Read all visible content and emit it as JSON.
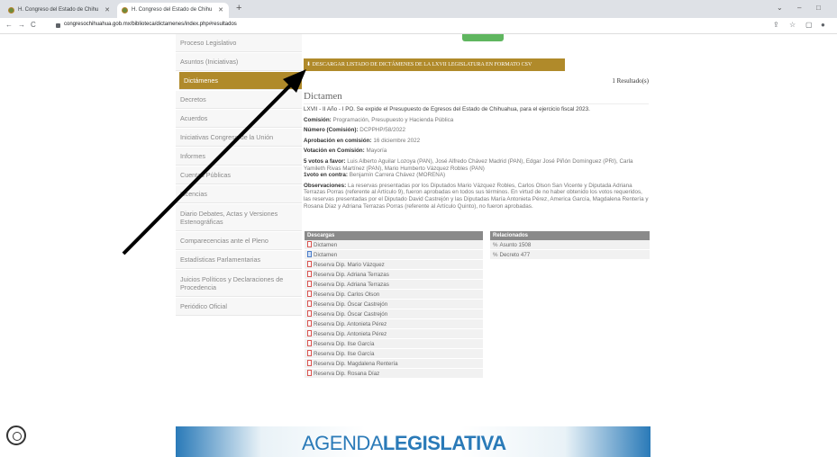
{
  "browser": {
    "tabs": [
      {
        "title": "H. Congreso del Estado de Chihu"
      },
      {
        "title": "H. Congreso del Estado de Chihu"
      }
    ],
    "url": "congresochihuahua.gob.mx/biblioteca/dictamenes/index.php#resultados"
  },
  "sidebar": {
    "items": [
      {
        "label": "Proceso Legislativo"
      },
      {
        "label": "Asuntos (Iniciativas)"
      },
      {
        "label": "Dictámenes"
      },
      {
        "label": "Decretos"
      },
      {
        "label": "Acuerdos"
      },
      {
        "label": "Iniciativas Congreso de la Unión"
      },
      {
        "label": "Informes"
      },
      {
        "label": "Cuentas Públicas"
      },
      {
        "label": "Licencias"
      },
      {
        "label": "Diario Debates, Actas y Versiones Estenográficas"
      },
      {
        "label": "Comparecencias ante el Pleno"
      },
      {
        "label": "Estadísticas Parlamentarias"
      },
      {
        "label": "Juicios Políticos y Declaraciones de Procedencia"
      },
      {
        "label": "Periódico Oficial"
      }
    ]
  },
  "main": {
    "csv_button": "DESCARGAR LISTADO DE DICTÁMENES DE LA LXVII LEGISLATURA EN FORMATO CSV",
    "results": "1 Resultado(s)",
    "title": "Dictamen",
    "summary": "LXVII - II Año - I PO. Se expide el Presupuesto de Egresos del Estado de Chihuahua, para el ejercicio fiscal 2023.",
    "comision_label": "Comisión:",
    "comision_value": "Programación, Presupuesto y Hacienda Pública",
    "numero_label": "Número (Comisión):",
    "numero_value": "DCPPHP/58/2022",
    "aprobacion_label": "Aprobación en comisión:",
    "aprobacion_value": "16 diciembre 2022",
    "votacion_label": "Votación en Comisión:",
    "votacion_value": "Mayoría",
    "favor_label": "5 votos a favor:",
    "favor_value": "Luis Alberto Aguilar Lozoya (PAN), José Alfredo Chávez Madrid (PAN), Edgar José Piñón Domínguez (PRI), Carla Yamileth Rivas Martínez (PAN), Mario Humberto Vázquez Robles (PAN)",
    "contra_label": "1voto en contra:",
    "contra_value": "Benjamín Carrera Chávez (MORENA)",
    "obs_label": "Observaciones:",
    "obs_value": "La reservas presentadas por los Diputados Mario Vázquez Robles, Carlos Olson San Vicente y Diputada Adriana Terrazas Porras (referente al Artículo 9), fueron aprobadas en todos sus términos. En virtud de no haber obtenido los votos requeridos, las reservas presentadas por el Diputado David Castrejón y las Diputadas María Antonieta Pérez, America García, Magdalena Rentería y Rosana Díaz y Adriana Terrazas Porras (referente al Artículo Quinto), no fueron aprobadas."
  },
  "downloads": {
    "header": "Descargas",
    "items": [
      {
        "label": "Dictamen",
        "icon": "pdf-icon"
      },
      {
        "label": "Dictamen",
        "icon": "word-icon"
      },
      {
        "label": "Reserva Dip. Mario Vázquez",
        "icon": "pdf-icon"
      },
      {
        "label": "Reserva Dip. Adriana Terrazas",
        "icon": "pdf-icon"
      },
      {
        "label": "Reserva Dip. Adriana Terrazas",
        "icon": "pdf-icon"
      },
      {
        "label": "Reserva Dip. Carlos Olson",
        "icon": "pdf-icon"
      },
      {
        "label": "Reserva Dip. Óscar Castrejón",
        "icon": "pdf-icon"
      },
      {
        "label": "Reserva Dip. Óscar Castrejón",
        "icon": "pdf-icon"
      },
      {
        "label": "Reserva Dip. Antonieta Pérez",
        "icon": "pdf-icon"
      },
      {
        "label": "Reserva Dip. Antonieta Pérez",
        "icon": "pdf-icon"
      },
      {
        "label": "Reserva Dip. Ilse García",
        "icon": "pdf-icon"
      },
      {
        "label": "Reserva Dip. Ilse García",
        "icon": "pdf-icon"
      },
      {
        "label": "Reserva Dip. Magdalena Rentería",
        "icon": "pdf-icon"
      },
      {
        "label": "Reserva Dip. Rosana Díaz",
        "icon": "pdf-icon"
      }
    ]
  },
  "related": {
    "header": "Relacionados",
    "items": [
      {
        "label": "Asunto 1508"
      },
      {
        "label": "Decreto 477"
      }
    ]
  },
  "banner": {
    "text_light": "AGENDA",
    "text_bold": "LEGISLATIVA"
  },
  "colors": {
    "accent": "#b08a2a",
    "banner_blue": "#2a7ab8",
    "annotation_arrow": "#000000"
  }
}
